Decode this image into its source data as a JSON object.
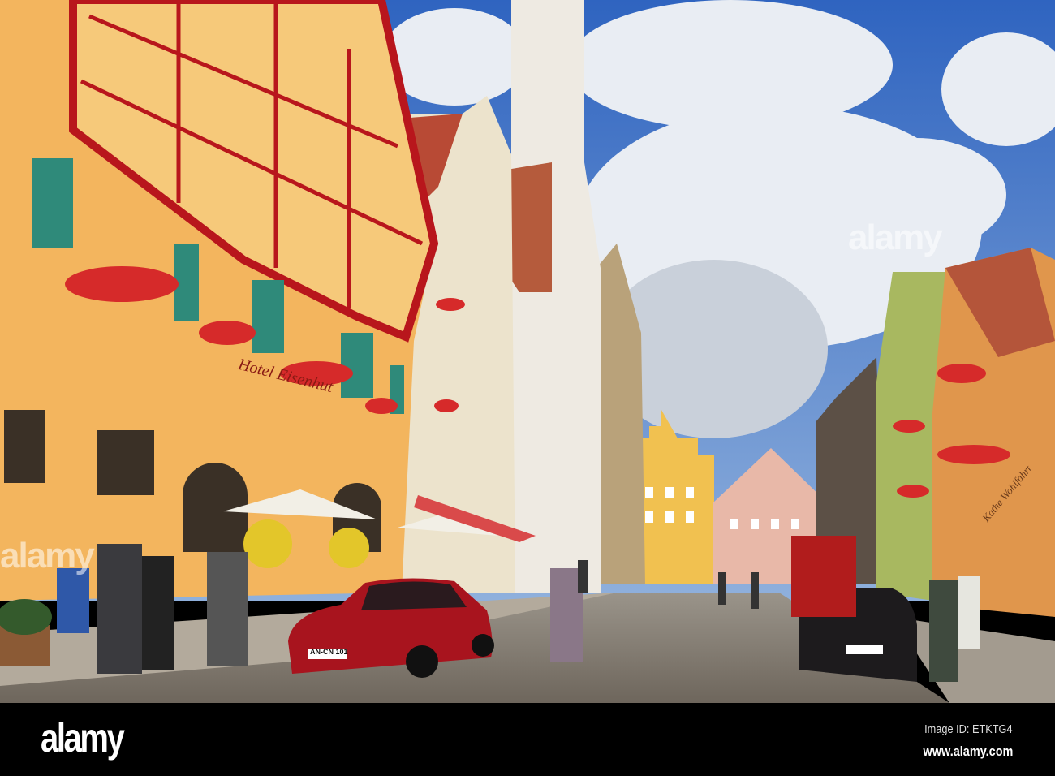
{
  "photo": {
    "signs": {
      "hotel_facade": "Hotel Eisenhut",
      "shop_sign": "Kathe Wohlfahrt"
    },
    "plates": [
      "AN-CN 101"
    ]
  },
  "watermarks": [
    "alamy",
    "alamy"
  ],
  "footer": {
    "logo": "alamy",
    "image_id": "Image ID: ETKTG4",
    "url": "www.alamy.com"
  },
  "colors": {
    "sky": "#3f72c6",
    "facade_yellow": "#f0b757",
    "timber_red": "#b8161c",
    "car_red": "#a8141e",
    "footer": "#000000"
  }
}
